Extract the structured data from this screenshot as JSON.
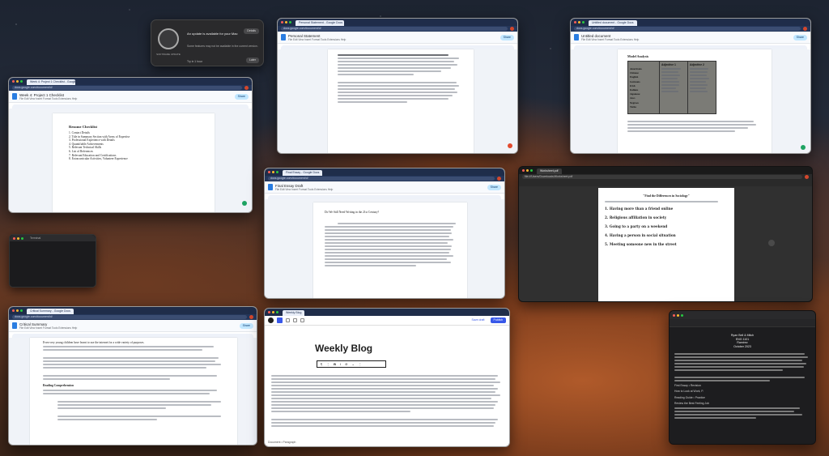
{
  "colors": {
    "chrome_dark": "#1f2d4a",
    "docs_blue": "#2a7de1",
    "share_bg": "#c2e7ff",
    "wp_blue": "#3858e9",
    "avatar": "#d3472c",
    "fab_green": "#1ea362",
    "fab_red": "#e24b2f",
    "dark_app": "#1d1d1f"
  },
  "notification": {
    "app_caption": "SOFTWARE UPDATE",
    "title": "An update is available for your Mac",
    "body": "Some features may not be available in the current version.",
    "button_details": "Details",
    "button_later": "Later",
    "checkbox": "Try in 1 hour"
  },
  "windows": {
    "top_center": {
      "tab": "Personal Statement - Google Docs",
      "url": "docs.google.com/document/d/",
      "title": "Personal Statement",
      "menu": "File  Edit  View  Insert  Format  Tools  Extensions  Help"
    },
    "top_right": {
      "tab": "Untitled document - Google Docs",
      "url": "docs.google.com/document/d/",
      "title": "Untitled document",
      "menu": "File  Edit  View  Insert  Format  Tools  Extensions  Help",
      "caption": "Model Analysis",
      "table_header_left": "Adjective 1",
      "table_header_right": "Adjective 2",
      "table_rows": [
        "Americans",
        "Chinese",
        "English",
        "Germans",
        "Irish",
        "Italians",
        "Japanese",
        "Jews",
        "Negroes",
        "Turks"
      ]
    },
    "left_checklist": {
      "tab": "Week 4: Project 1 Checklist - Google Docs",
      "url": "docs.google.com/document/d/",
      "title": "Week 4: Project 1 Checklist",
      "menu": "File  Edit  View  Insert  Format  Tools  Extensions  Help",
      "heading": "Resume Checklist",
      "items": [
        "1. Contact Details",
        "2. Title in Summary Section with Areas of Expertise",
        "3. Professional Experience with Details",
        "4. Quantifiable Achievements",
        "5. Relevant Technical Skills",
        "6. List of References",
        "7. Relevant Education and Certifications",
        "8. Extracurricular Activities, Volunteer Experience"
      ]
    },
    "center_mid": {
      "tab": "Final Essay - Google Docs",
      "url": "docs.google.com/document/d/",
      "title": "Final Essay Draft",
      "menu": "File  Edit  View  Insert  Format  Tools  Extensions  Help",
      "heading_line": "Do We Still Need Writing in the 21st Century?"
    },
    "right_mid": {
      "tab": "Worksheet.pdf",
      "url": "file:///Users/Downloads/Worksheet.pdf",
      "heading": "\"Find the Differences in Sociology\"",
      "items": [
        "1. Having more than a friend online",
        "2. Religious affiliation in society",
        "3. Going to a party on a weekend",
        "4. Having a person in social situation",
        "5. Meeting someone new in the street"
      ]
    },
    "bottom_left": {
      "tab": "Critical Summary - Google Docs",
      "url": "docs.google.com/document/d/",
      "title": "Critical Summary",
      "menu": "File  Edit  View  Insert  Format  Tools  Extensions  Help",
      "subheading": "Reading Comprehension",
      "intro": "Even very young children have learnt to use the internet for a wide variety of purposes."
    },
    "blog": {
      "title": "Weekly Blog",
      "save": "Save draft",
      "publish": "Publish",
      "footer": "Document • Paragraph"
    },
    "pages_doc": {
      "header_lines": [
        "Ryan Bell & Mitch",
        "ENG 1101",
        "Ramirez",
        "October 2023"
      ],
      "lines": [
        "First Essay • Revision",
        "How to Look at Work, P.",
        "Reading Guide • Practice",
        "Review the Best Feeling Job"
      ]
    }
  },
  "terminal": {
    "title": "Terminal"
  }
}
